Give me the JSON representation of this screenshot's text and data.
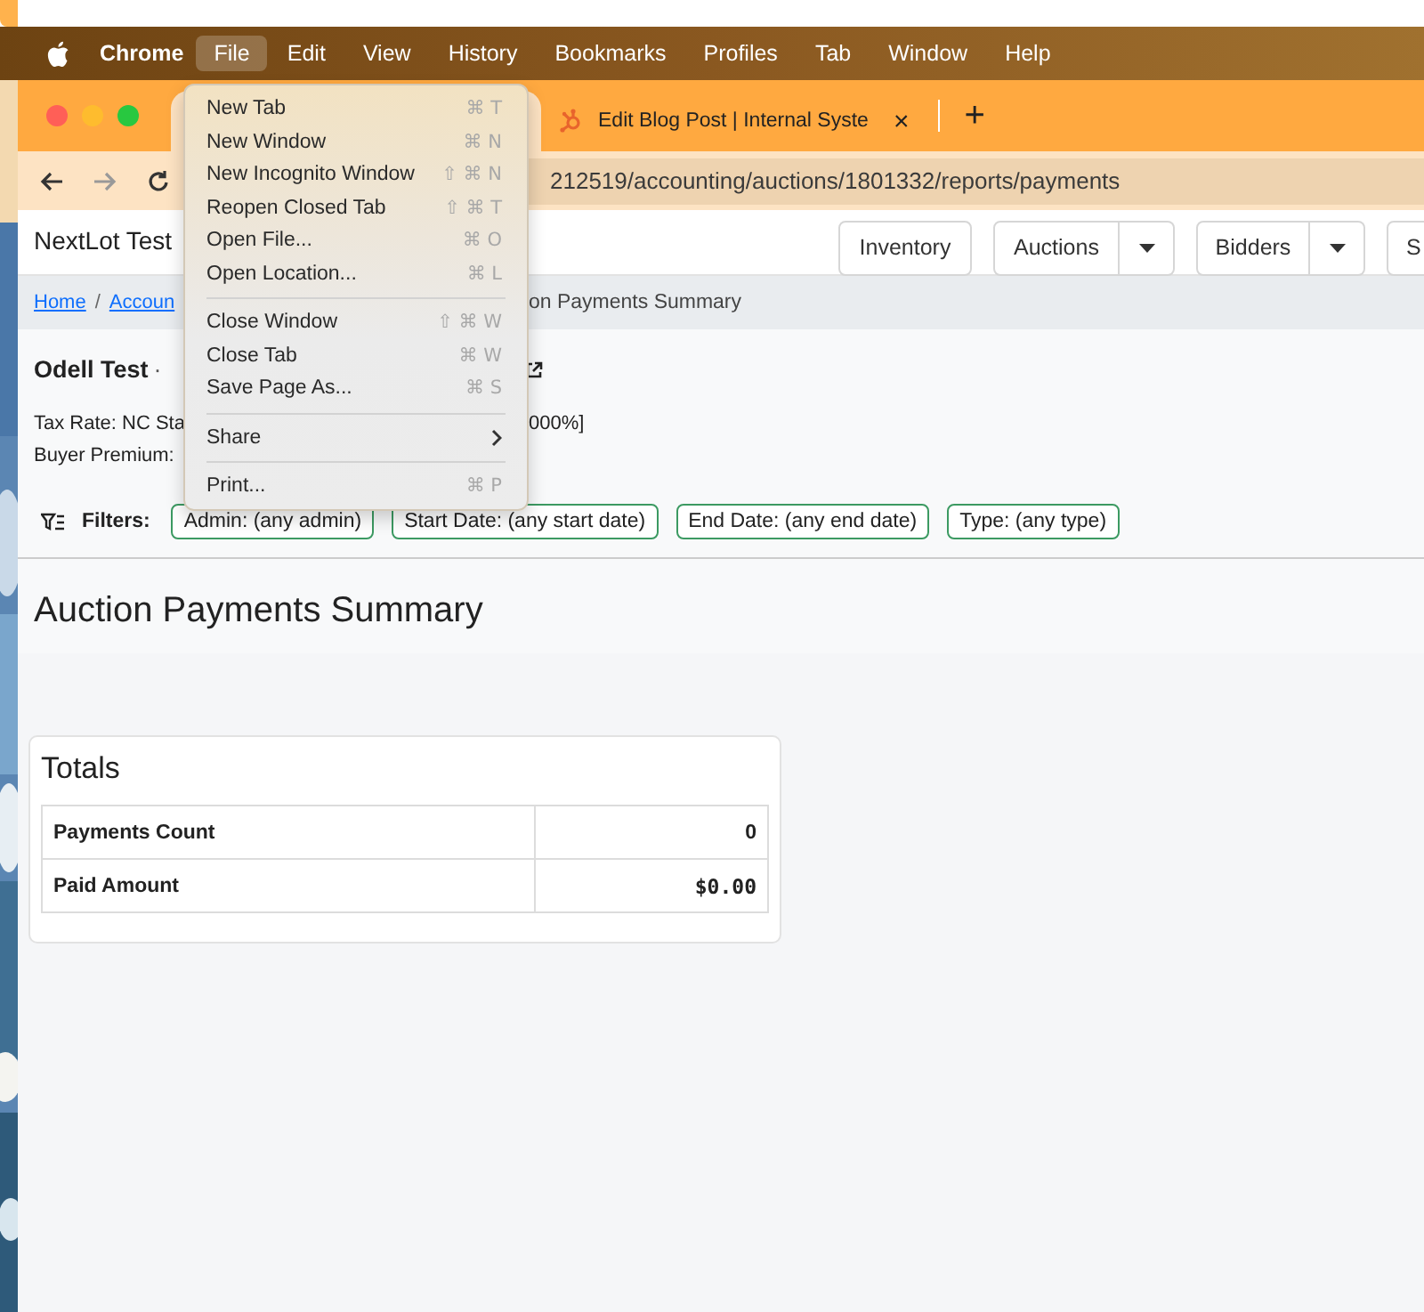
{
  "menu_bar": {
    "app_name": "Chrome",
    "items": [
      {
        "label": "File",
        "selected": true
      },
      {
        "label": "Edit",
        "selected": false
      },
      {
        "label": "View",
        "selected": false
      },
      {
        "label": "History",
        "selected": false
      },
      {
        "label": "Bookmarks",
        "selected": false
      },
      {
        "label": "Profiles",
        "selected": false
      },
      {
        "label": "Tab",
        "selected": false
      },
      {
        "label": "Window",
        "selected": false
      },
      {
        "label": "Help",
        "selected": false
      }
    ]
  },
  "browser": {
    "tabs": [
      {
        "selected": true
      },
      {
        "label": "Edit Blog Post | Internal Syste",
        "close": "×",
        "selected": false
      }
    ],
    "new_tab": "+",
    "address": "212519/accounting/auctions/1801332/reports/payments"
  },
  "page": {
    "brand": "NextLot Test",
    "nav": [
      {
        "label": "Inventory",
        "dropdown": false
      },
      {
        "label": "Auctions",
        "dropdown": true
      },
      {
        "label": "Bidders",
        "dropdown": true
      },
      {
        "label": "S",
        "dropdown": false
      }
    ],
    "breadcrumb": [
      {
        "label": "Home",
        "kind": "link"
      },
      {
        "label": "/",
        "kind": "sep"
      },
      {
        "label": "Accoun",
        "kind": "link"
      },
      {
        "label": "on Payments Summary",
        "kind": "text"
      }
    ],
    "auction": {
      "name": "Odell Test",
      "dot": "·"
    },
    "tax_rate": [
      "Tax Rate: NC Sta",
      "000%]"
    ],
    "buyer_premium": "Buyer Premium:",
    "filters": {
      "label": "Filters:",
      "chips": [
        "Admin: (any admin)",
        "Start Date: (any start date)",
        "End Date: (any end date)",
        "Type: (any type)"
      ]
    },
    "heading": "Auction Payments Summary",
    "totals": {
      "title": "Totals",
      "rows": [
        {
          "label": "Payments Count",
          "value": "0"
        },
        {
          "label": "Paid Amount",
          "value": "$0.00"
        }
      ]
    }
  },
  "file_menu": [
    {
      "kind": "item",
      "label": "New Tab",
      "shortcut": "⌘ T"
    },
    {
      "kind": "item",
      "label": "New Window",
      "shortcut": "⌘ N"
    },
    {
      "kind": "item",
      "label": "New Incognito Window",
      "shortcut": "⇧ ⌘ N"
    },
    {
      "kind": "item",
      "label": "Reopen Closed Tab",
      "shortcut": "⇧ ⌘ T"
    },
    {
      "kind": "item",
      "label": "Open File...",
      "shortcut": "⌘ O"
    },
    {
      "kind": "item",
      "label": "Open Location...",
      "shortcut": "⌘ L"
    },
    {
      "kind": "separator"
    },
    {
      "kind": "item",
      "label": "Close Window",
      "shortcut": "⇧ ⌘ W"
    },
    {
      "kind": "item",
      "label": "Close Tab",
      "shortcut": "⌘ W"
    },
    {
      "kind": "item",
      "label": "Save Page As...",
      "shortcut": "⌘ S"
    },
    {
      "kind": "separator"
    },
    {
      "kind": "submenu",
      "label": "Share"
    },
    {
      "kind": "separator"
    },
    {
      "kind": "item",
      "label": "Print...",
      "shortcut": "⌘ P"
    }
  ]
}
